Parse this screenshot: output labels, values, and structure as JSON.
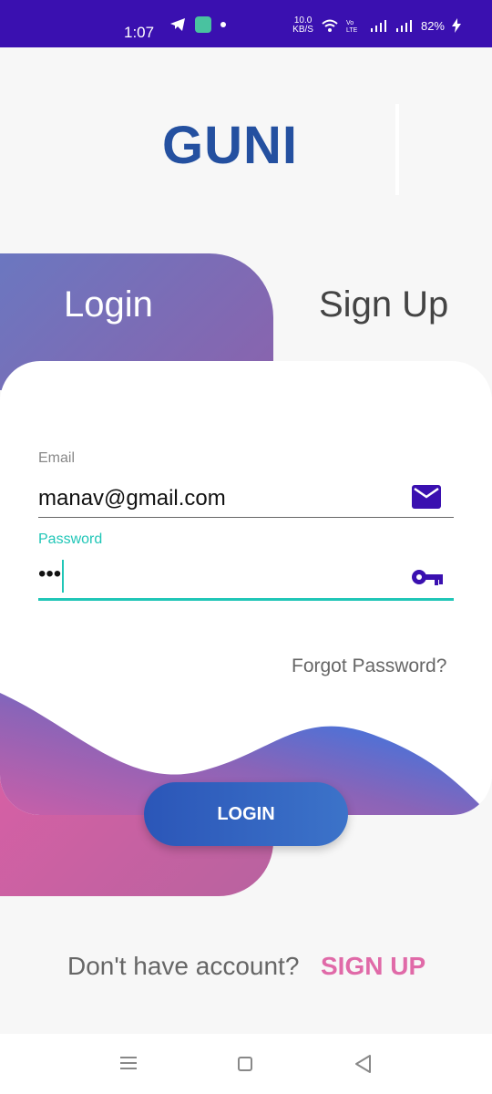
{
  "status_bar": {
    "time": "1:07",
    "network_speed": "10.0\nKB/S",
    "battery": "82%",
    "accent_color": "#3a10b0"
  },
  "logo": {
    "text": "GUNI",
    "color": "#2450a0"
  },
  "tabs": [
    {
      "label": "Login",
      "active": true
    },
    {
      "label": "Sign Up",
      "active": false
    }
  ],
  "form": {
    "email_label": "Email",
    "email_value": "manav@gmail.com",
    "email_icon": "mail-icon",
    "password_label": "Password",
    "password_value": "•••",
    "password_icon": "key-icon",
    "forgot_password": "Forgot Password?",
    "login_button": "LOGIN"
  },
  "footer": {
    "question": "Don't have account?",
    "signup_link": "SIGN UP"
  },
  "nav_bar": {
    "buttons": [
      "menu-icon",
      "home-icon",
      "back-icon"
    ]
  },
  "colors": {
    "focus": "#20c6b7",
    "pink": "#e06aa8",
    "primary_blue": "#2b56b8",
    "purple": "#3a10b0"
  }
}
